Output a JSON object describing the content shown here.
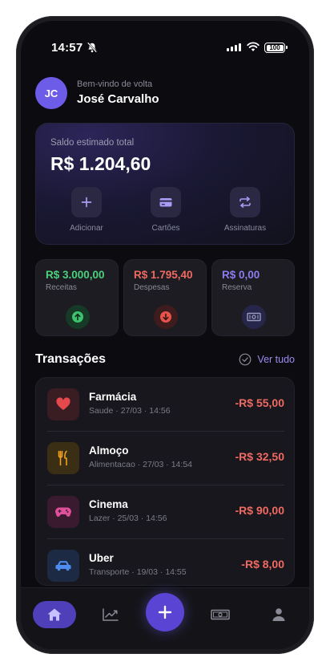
{
  "status_bar": {
    "time": "14:57",
    "battery": "100"
  },
  "header": {
    "initials": "JC",
    "welcome": "Bem-vindo de volta",
    "name": "José Carvalho"
  },
  "balance": {
    "label": "Saldo estimado total",
    "value": "R$ 1.204,60",
    "actions": [
      {
        "label": "Adicionar",
        "icon": "plus-icon"
      },
      {
        "label": "Cartões",
        "icon": "card-icon"
      },
      {
        "label": "Assinaturas",
        "icon": "repeat-icon"
      }
    ]
  },
  "summary": [
    {
      "value": "R$ 3.000,00",
      "label": "Receitas",
      "color": "#4cd07d",
      "icon": "arrow-up-icon"
    },
    {
      "value": "R$ 1.795,40",
      "label": "Despesas",
      "color": "#f06a62",
      "icon": "arrow-down-icon"
    },
    {
      "value": "R$ 0,00",
      "label": "Reserva",
      "color": "#8b7cf0",
      "icon": "cash-icon"
    }
  ],
  "transactions": {
    "title": "Transações",
    "see_all": "Ver tudo",
    "items": [
      {
        "name": "Farmácia",
        "meta": "Saude · 27/03 · 14:56",
        "amount": "-R$ 55,00",
        "icon": "heart-icon",
        "color": "#e5484d"
      },
      {
        "name": "Almoço",
        "meta": "Alimentacao · 27/03 · 14:54",
        "amount": "-R$ 32,50",
        "icon": "fork-knife-icon",
        "color": "#f0a020"
      },
      {
        "name": "Cinema",
        "meta": "Lazer · 25/03 · 14:56",
        "amount": "-R$ 90,00",
        "icon": "gamepad-icon",
        "color": "#e0509a"
      },
      {
        "name": "Uber",
        "meta": "Transporte · 19/03 · 14:55",
        "amount": "-R$ 8,00",
        "icon": "car-icon",
        "color": "#4f8cf0"
      }
    ]
  },
  "nav": [
    "home-icon",
    "chart-icon",
    "add-icon",
    "cash-icon",
    "user-icon"
  ]
}
